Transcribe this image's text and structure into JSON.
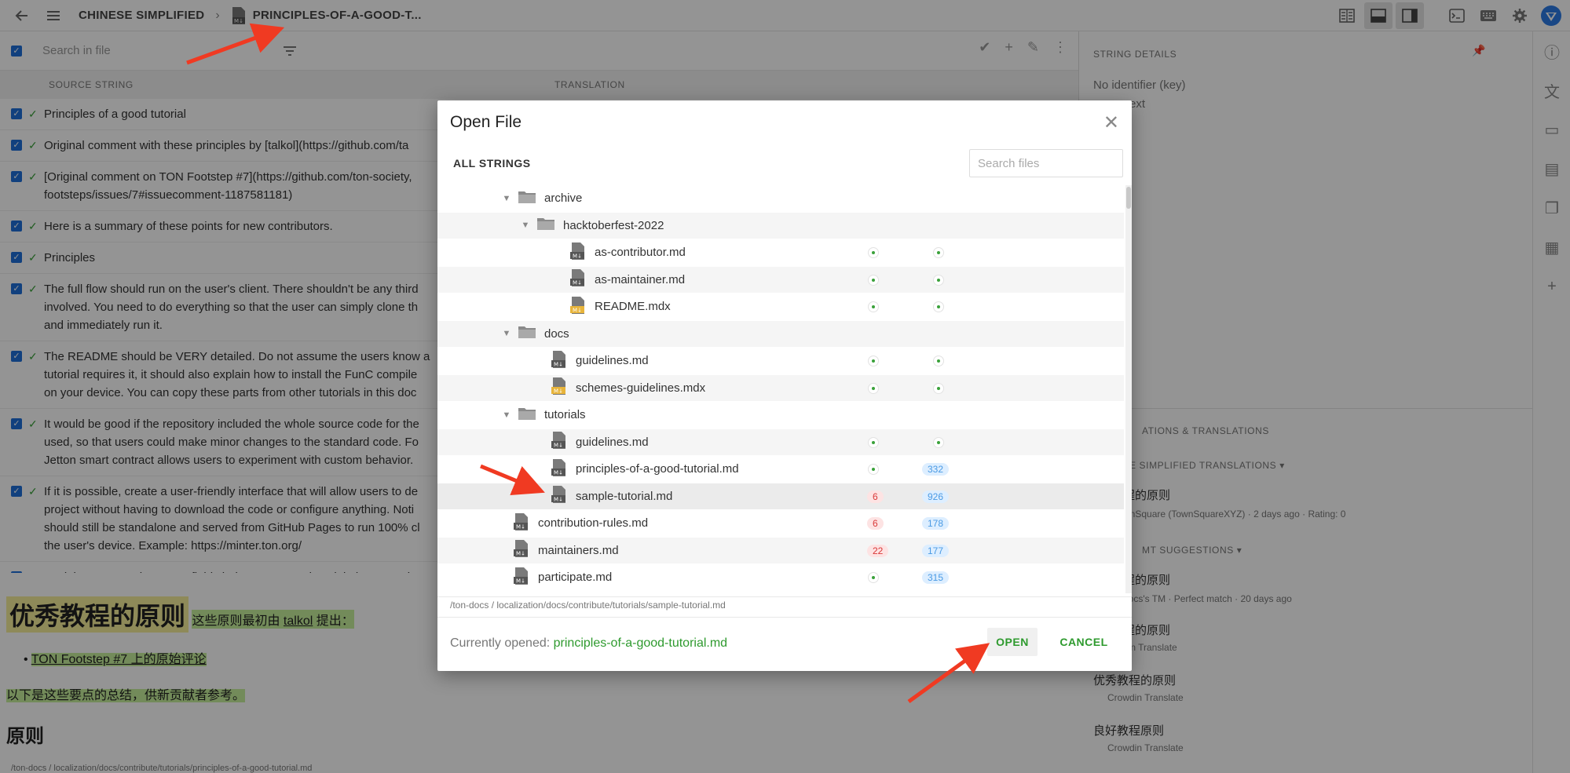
{
  "topbar": {
    "project": "CHINESE SIMPLIFIED",
    "file": "PRINCIPLES-OF-A-GOOD-T..."
  },
  "editor": {
    "search_placeholder": "Search in file",
    "col_source": "SOURCE STRING",
    "col_translation": "TRANSLATION",
    "rows": [
      [
        "Principles of a good tutorial"
      ],
      [
        "Original comment with these principles by [talkol](https://github.com/ta"
      ],
      [
        "[Original comment on TON Footstep #7](https://github.com/ton-society,",
        "footsteps/issues/7#issuecomment-1187581181)"
      ],
      [
        "Here is a summary of these points for new contributors."
      ],
      [
        "Principles"
      ],
      [
        "The full flow should run on the user's client. There shouldn't be any third",
        "involved. You need to do everything so that the user can simply clone th",
        "and immediately run it."
      ],
      [
        "The README should be VERY detailed. Do not assume the users know a",
        "tutorial requires it, it should also explain how to install the FunC compile",
        "on your device. You can copy these parts from other tutorials in this doc"
      ],
      [
        "It would be good if the repository included the whole source code for the",
        "used, so that users could make minor changes to the standard code. Fo",
        "Jetton smart contract allows users to experiment with custom behavior."
      ],
      [
        "If it is possible, create a user-friendly interface that will allow users to de",
        "project without having to download the code or configure anything. Noti",
        "should still be standalone and served from GitHub Pages to run 100% cl",
        "the user's device. Example: https://minter.ton.org/"
      ],
      [
        "Explain to users what every field choice means and explain best practice"
      ]
    ]
  },
  "preview": {
    "h1": "优秀教程的原则",
    "p1_before": "这些原则最初由 ",
    "p1_link": "talkol",
    "p1_after": " 提出：",
    "li1": "TON Footstep #7 上的原始评论",
    "p2": "以下是这些要点的总结，供新贡献者参考。",
    "h2": "原则",
    "path": "/ton-docs / localization/docs/contribute/tutorials/principles-of-a-good-tutorial.md"
  },
  "right_panel": {
    "title": "STRING DETAILS",
    "no_identifier": "No identifier (key)",
    "context": "ext",
    "section2": "ATIONS & TRANSLATIONS",
    "trans_header": "E SIMPLIFIED TRANSLATIONS ▾",
    "trans1": "程的原则",
    "trans1_meta": "wnSquare (TownSquareXYZ)  · 2 days ago · Rating: 0",
    "mt_header": "MT SUGGESTIONS ▾",
    "s1": "程的原则",
    "s1_meta": "docs's TM · Perfect match · 20 days ago",
    "s2": "程的原则",
    "s2_meta": "din Translate",
    "s3": "优秀教程的原则",
    "s3_meta": "Crowdin Translate",
    "s4": "良好教程原则",
    "s4_meta": "Crowdin Translate"
  },
  "modal": {
    "title": "Open File",
    "tab": "ALL STRINGS",
    "search_placeholder": "Search files",
    "tree": [
      {
        "name": "archive",
        "type": "folder",
        "level": 0
      },
      {
        "name": "hacktoberfest-2022",
        "type": "folder",
        "level": 1
      },
      {
        "name": "as-contributor.md",
        "type": "md",
        "level": 2,
        "left": "dot",
        "right": "dot"
      },
      {
        "name": "as-maintainer.md",
        "type": "md",
        "level": 2,
        "left": "dot",
        "right": "dot"
      },
      {
        "name": "README.mdx",
        "type": "mdx",
        "level": 2,
        "left": "dot",
        "right": "dot"
      },
      {
        "name": "docs",
        "type": "folder",
        "level": 0
      },
      {
        "name": "guidelines.md",
        "type": "md",
        "level": 1,
        "left": "dot",
        "right": "dot"
      },
      {
        "name": "schemes-guidelines.mdx",
        "type": "mdx",
        "level": 1,
        "left": "dot",
        "right": "dot"
      },
      {
        "name": "tutorials",
        "type": "folder",
        "level": 0
      },
      {
        "name": "guidelines.md",
        "type": "md",
        "level": 1,
        "left": "dot",
        "right": "dot"
      },
      {
        "name": "principles-of-a-good-tutorial.md",
        "type": "md",
        "level": 1,
        "left": "dot",
        "right": "332"
      },
      {
        "name": "sample-tutorial.md",
        "type": "md",
        "level": 1,
        "left": "6",
        "right": "926",
        "selected": true
      },
      {
        "name": "contribution-rules.md",
        "type": "md",
        "level": -1,
        "left": "6",
        "right": "178"
      },
      {
        "name": "maintainers.md",
        "type": "md",
        "level": -1,
        "left": "22",
        "right": "177"
      },
      {
        "name": "participate.md",
        "type": "md",
        "level": -1,
        "left": "dot",
        "right": "315"
      }
    ],
    "path": "/ton-docs / localization/docs/contribute/tutorials/sample-tutorial.md",
    "currently_label": "Currently opened: ",
    "currently_file": "principles-of-a-good-tutorial.md",
    "open": "OPEN",
    "cancel": "CANCEL"
  },
  "colors": {
    "accent_green": "#2e9a2e",
    "checkbox_blue": "#1e6fd9",
    "arrow_red": "#f03a22"
  }
}
